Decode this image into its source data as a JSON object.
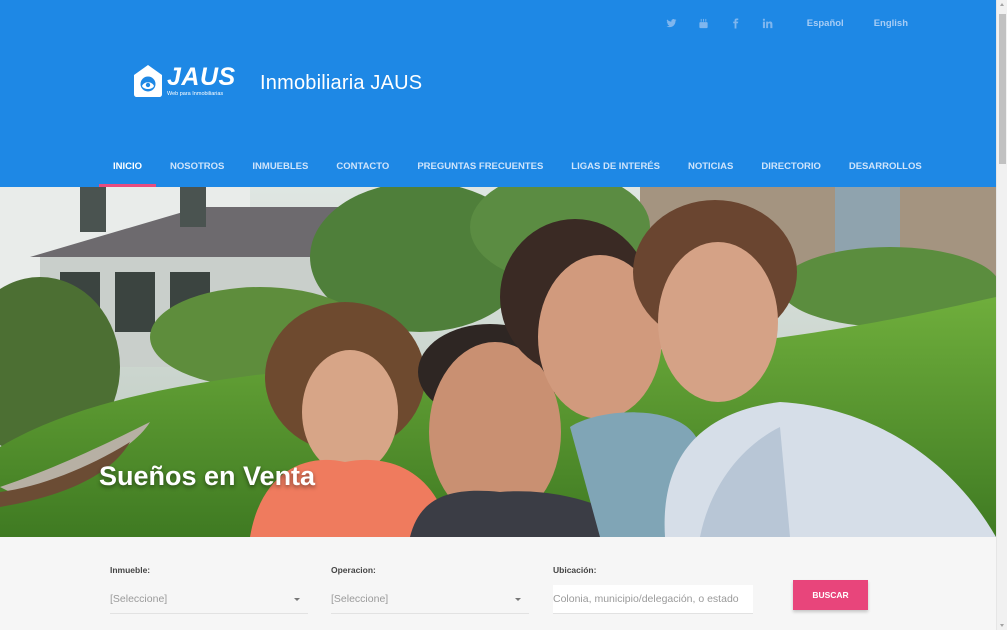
{
  "colors": {
    "header_blue": "#1e88e5",
    "accent_pink": "#e8457b",
    "search_bg": "#f6f6f6"
  },
  "topbar": {
    "social_icons": [
      "twitter-icon",
      "youtube-icon",
      "facebook-icon",
      "linkedin-icon"
    ],
    "lang_es": "Español",
    "lang_en": "English"
  },
  "brand": {
    "logo_word": "JAUS",
    "logo_tagline": "Web para Inmobiliarias",
    "site_title": "Inmobiliaria JAUS"
  },
  "nav": {
    "items": [
      "INICIO",
      "NOSOTROS",
      "INMUEBLES",
      "CONTACTO",
      "PREGUNTAS FRECUENTES",
      "LIGAS DE INTERÉS",
      "NOTICIAS",
      "DIRECTORIO",
      "DESARROLLOS"
    ],
    "active": "INICIO"
  },
  "hero": {
    "title": "Sueños en Venta"
  },
  "search": {
    "inmueble_label": "Inmueble:",
    "inmueble_value": "[Seleccione]",
    "operacion_label": "Operacion:",
    "operacion_value": "[Seleccione]",
    "ubicacion_label": "Ubicación:",
    "ubicacion_placeholder": "Colonia, municipio/delegación, o estado",
    "button_label": "BUSCAR"
  }
}
